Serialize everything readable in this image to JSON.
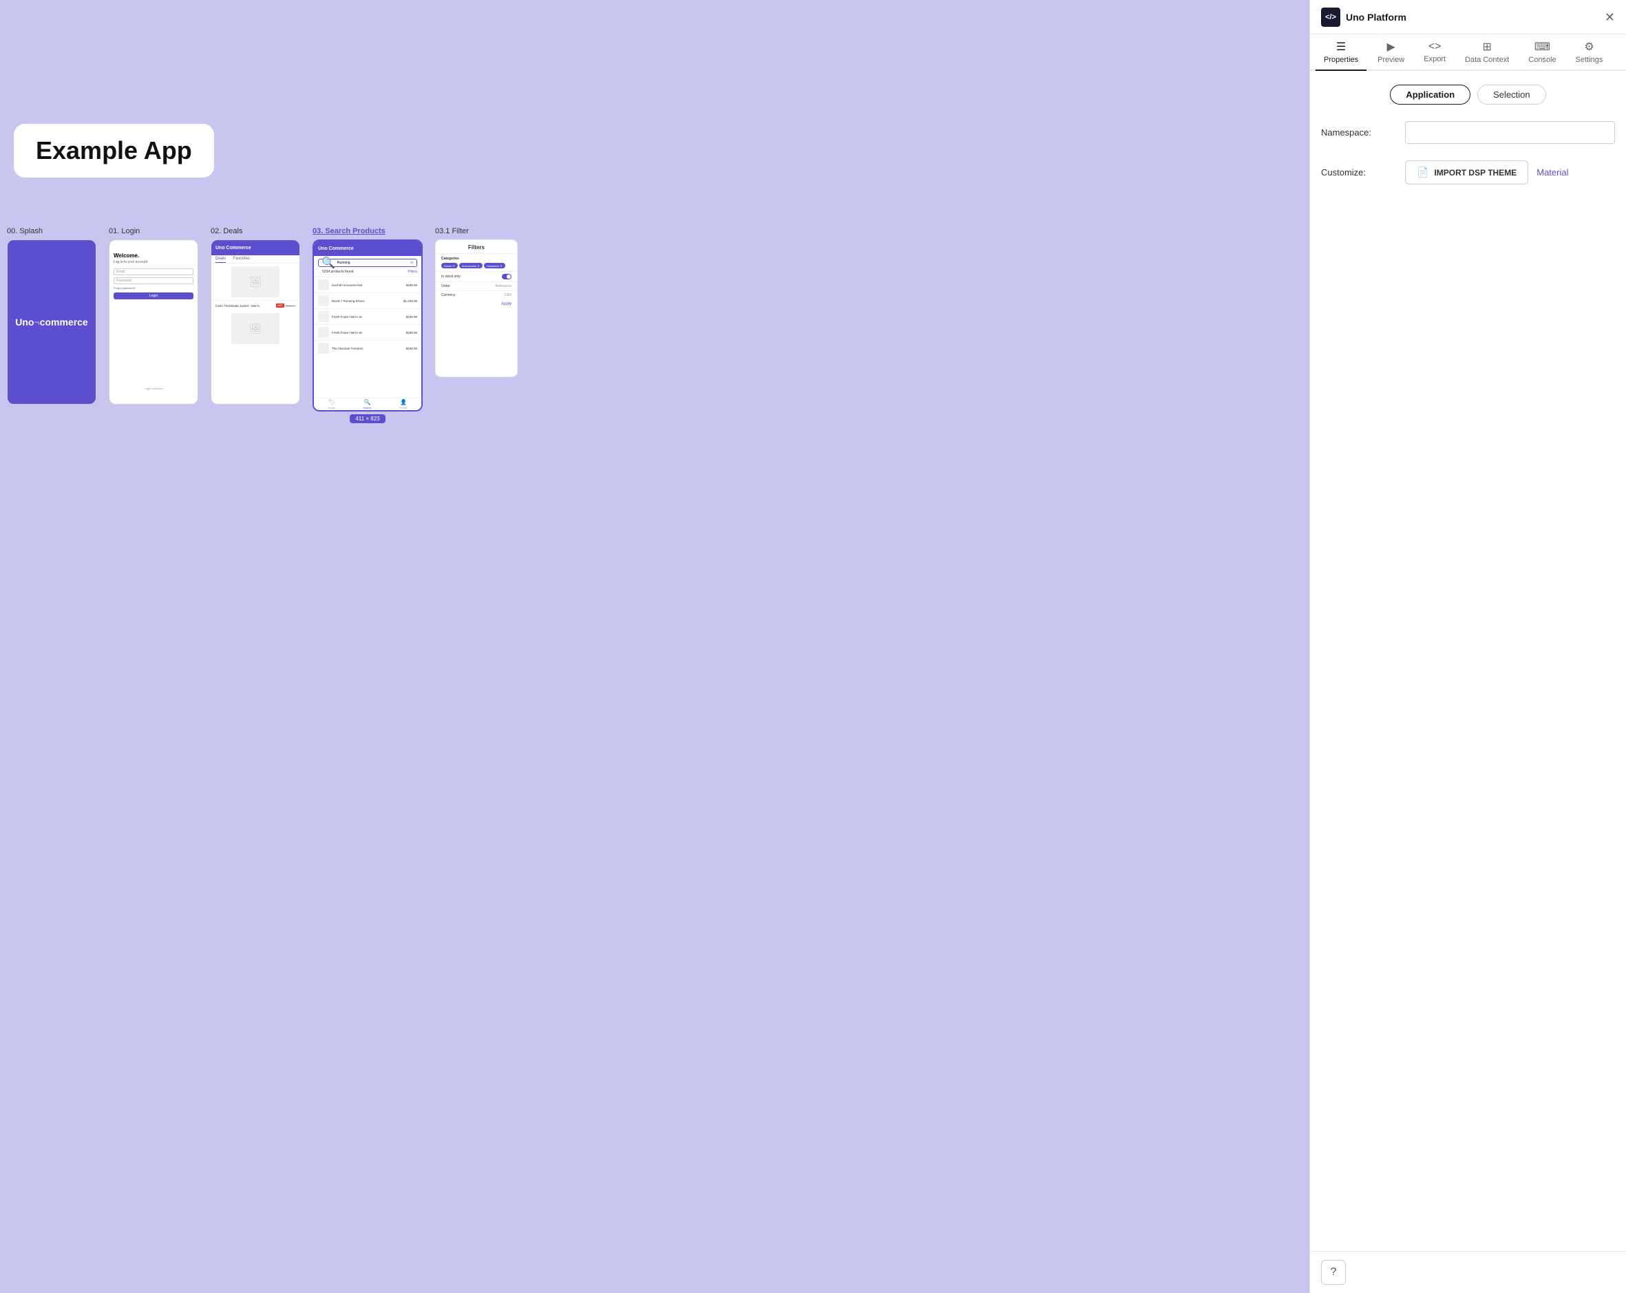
{
  "canvas": {
    "background_color": "#c8c5f0",
    "app_label": "Example App"
  },
  "screens": [
    {
      "label": "00. Splash",
      "type": "splash"
    },
    {
      "label": "01. Login",
      "type": "login"
    },
    {
      "label": "02. Deals",
      "type": "deals"
    },
    {
      "label": "03. Search Products",
      "type": "search",
      "active": true
    },
    {
      "label": "03.1 Filter",
      "type": "filter"
    }
  ],
  "size_badge": "411 × 823",
  "panel": {
    "title": "Uno Platform",
    "logo_text": "</>",
    "toolbar": [
      {
        "label": "Properties",
        "icon": "☰",
        "active": true
      },
      {
        "label": "Preview",
        "icon": "▶"
      },
      {
        "label": "Export",
        "icon": "<>"
      },
      {
        "label": "Data Context",
        "icon": "⊞"
      },
      {
        "label": "Console",
        "icon": "⌨"
      },
      {
        "label": "Settings",
        "icon": "⚙"
      }
    ],
    "properties": {
      "tab_application": "Application",
      "tab_selection": "Selection",
      "namespace_label": "Namespace:",
      "namespace_value": "",
      "namespace_placeholder": "",
      "customize_label": "Customize:",
      "import_btn_label": "IMPORT DSP THEME",
      "material_link": "Material"
    },
    "help_label": "?"
  }
}
